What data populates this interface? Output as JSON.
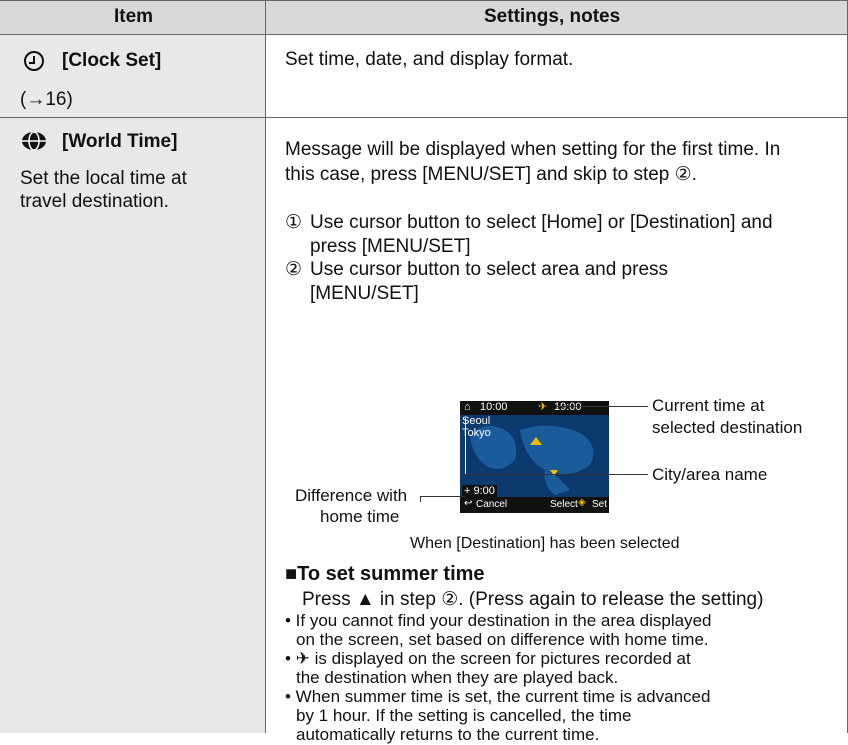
{
  "table": {
    "header": {
      "item": "Item",
      "settings": "Settings, notes"
    },
    "rows": [
      {
        "item_title": "[Clock Set]",
        "item_ref": "(→16)",
        "setting": "Set time, date, and display format."
      },
      {
        "item_title": "[World Time]",
        "item_desc_1": "Set the local time at",
        "item_desc_2": "travel destination.",
        "intro_1": "Message will be displayed when setting for the first time. In",
        "intro_2": "this case, press [MENU/SET] and skip to step ②.",
        "steps": [
          {
            "num": "①",
            "line1": "Use cursor button to select [Home] or [Destination] and",
            "line2": "press [MENU/SET]"
          },
          {
            "num": "②",
            "line1": "Use cursor button to select area and press",
            "line2": "[MENU/SET]"
          }
        ],
        "screen": {
          "home_time": "10:00",
          "dest_time": "19:00",
          "city1": "Seoul",
          "city2": "Tokyo",
          "diff": "+ 9:00",
          "cancel": "Cancel",
          "select_set": "Select",
          "set": "Set"
        },
        "callouts": {
          "current_1": "Current time at",
          "current_2": "selected destination",
          "city": "City/area name",
          "diff_1": "Difference with",
          "diff_2": "home time"
        },
        "caption": "When [Destination] has been selected",
        "summer_heading": "■To set summer time",
        "summer_text": "Press ▲ in step ②. (Press again to release the setting)",
        "notes": [
          [
            "• If you cannot find your destination in the area displayed",
            "on the screen, set based on difference with home time."
          ],
          [
            "• ✈ is displayed on the screen for pictures recorded at",
            "the destination when they are played back."
          ],
          [
            "• When summer time is set, the current time is advanced",
            "by 1 hour. If the setting is cancelled, the time",
            "automatically returns to the current time."
          ]
        ]
      }
    ]
  }
}
